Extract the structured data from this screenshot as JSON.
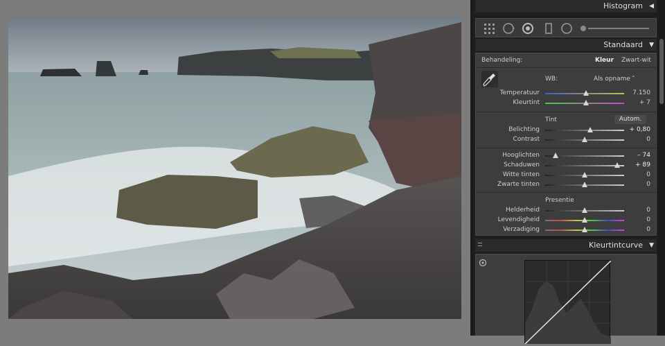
{
  "panels": {
    "histogram": {
      "title": "Histogram",
      "toggle": "◀"
    },
    "basic": {
      "title": "Standaard",
      "toggle": "▼",
      "treatment": {
        "label": "Behandeling:",
        "color": "Kleur",
        "bw": "Zwart-wit"
      },
      "wb": {
        "label": "WB:",
        "value": "Als opname",
        "arrows": "⌃"
      },
      "temperature": {
        "label": "Temperatuur",
        "value": "7.150",
        "fraction": 0.52
      },
      "tint_slider": {
        "label": "Kleurtint",
        "value": "+ 7",
        "fraction": 0.52
      },
      "tone": {
        "label": "Tint",
        "auto": "Autom."
      },
      "exposure": {
        "label": "Belichting",
        "value": "+ 0,80",
        "fraction": 0.57
      },
      "contrast": {
        "label": "Contrast",
        "value": "0",
        "fraction": 0.5
      },
      "highlights": {
        "label": "Hooglichten",
        "value": "– 74",
        "fraction": 0.13
      },
      "shadows": {
        "label": "Schaduwen",
        "value": "+ 89",
        "fraction": 0.91
      },
      "whites": {
        "label": "Witte tinten",
        "value": "0",
        "fraction": 0.5
      },
      "blacks": {
        "label": "Zwarte tinten",
        "value": "0",
        "fraction": 0.5
      },
      "presence": {
        "label": "Presentie"
      },
      "clarity": {
        "label": "Helderheid",
        "value": "0",
        "fraction": 0.5
      },
      "vibrance": {
        "label": "Levendigheid",
        "value": "0",
        "fraction": 0.5
      },
      "saturation": {
        "label": "Verzadiging",
        "value": "0",
        "fraction": 0.5
      }
    },
    "tonecurve": {
      "title": "Kleurtintcurve",
      "toggle": "▼"
    }
  },
  "colors": {
    "panel_bg": "#1e1e1e",
    "section_bg": "#3d3d3d",
    "text": "#cfcfcf"
  }
}
